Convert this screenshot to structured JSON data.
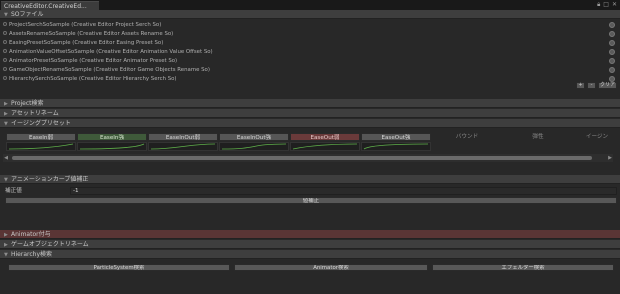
{
  "window": {
    "tab_title": "CreativeEditor.CreativeEd...",
    "icons": [
      "lock-icon",
      "maximize-icon",
      "close-icon"
    ]
  },
  "so_file": {
    "header": "SOファイル",
    "items": [
      "ProjectSerchSoSample (Creative Editor Project Serch So)",
      "AssetsRenameSoSample (Creative Editor Assets Rename So)",
      "EasingPresetSoSample (Creative Editor Easing Preset So)",
      "AnimationValueOffsetSoSample (Creative Editor Animation Value Offset So)",
      "AnimatorPresetSoSample (Creative Editor Animator Preset So)",
      "GameObjectRenameSoSample (Creative Editor Game Objects Rename So)",
      "HierarchySerchSoSample (Creative Editor Hierarchy Serch So)"
    ],
    "add_label": "+",
    "remove_label": "-",
    "clear_label": "クリア"
  },
  "sections": {
    "project_search": "Project検索",
    "asset_rename": "アセットリネーム",
    "easing_preset": "イージングプリセット",
    "animation_curve": "アニメーションカーブ値補正",
    "animator": "Animator付与",
    "gameobject_rename": "ゲームオブジェクトリネーム",
    "hierarchy_search": "Hierarchy検索"
  },
  "easing": {
    "buttons": [
      {
        "label": "EaseIn弱",
        "style": "normal"
      },
      {
        "label": "EaseIn強",
        "style": "green"
      },
      {
        "label": "EaseInOut弱",
        "style": "normal"
      },
      {
        "label": "EaseInOut強",
        "style": "normal"
      },
      {
        "label": "EaseOut弱",
        "style": "red"
      },
      {
        "label": "EaseOut強",
        "style": "normal"
      },
      {
        "label": "バウンド",
        "style": "dim"
      },
      {
        "label": "弾性",
        "style": "dim"
      },
      {
        "label": "イージン",
        "style": "dim"
      }
    ]
  },
  "curve_correction": {
    "field_label": "補正値",
    "field_value": "-1",
    "apply_label": "値補正"
  },
  "hierarchy": {
    "buttons": [
      "ParticleSystem検索",
      "Animator検索",
      "エフェルター検索"
    ]
  }
}
